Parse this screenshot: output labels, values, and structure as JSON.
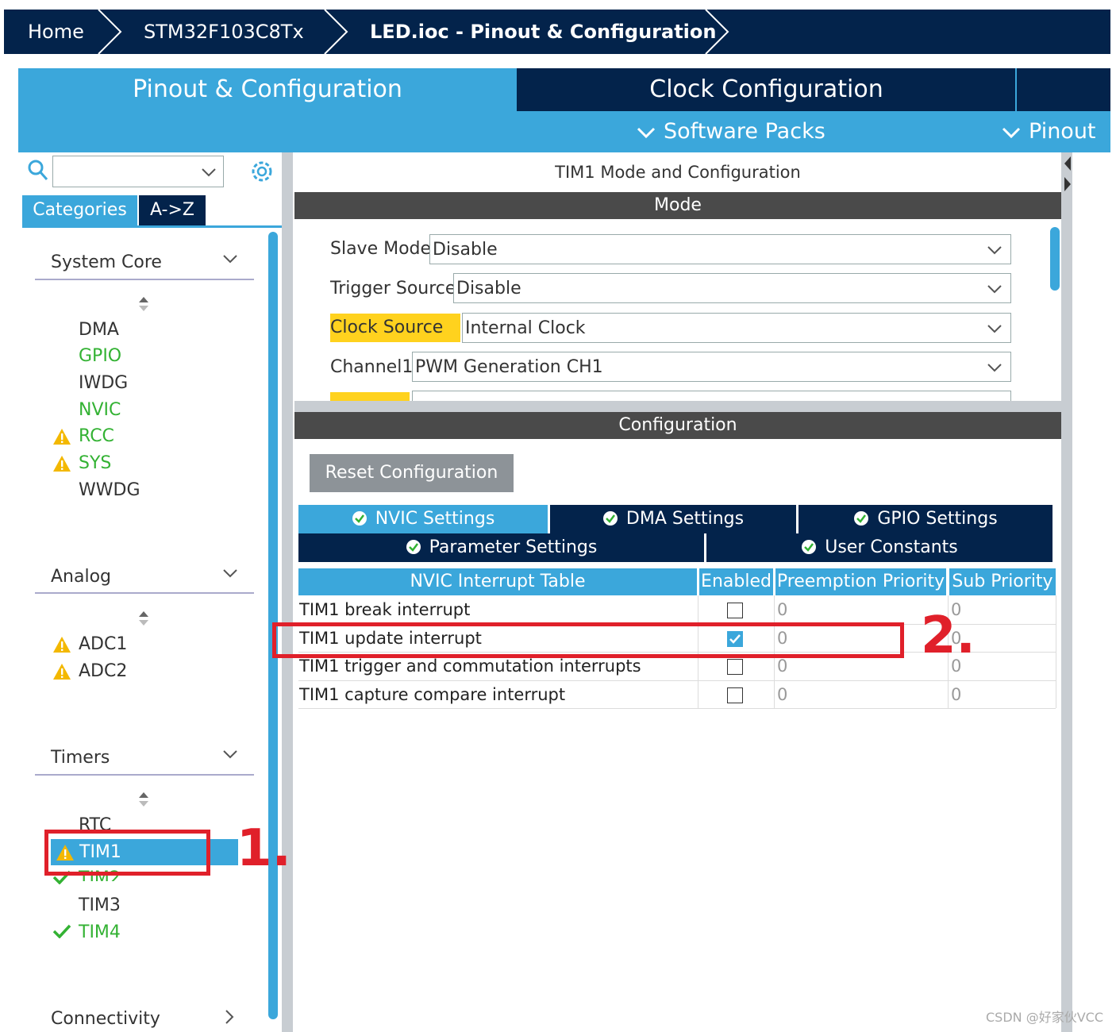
{
  "breadcrumb": {
    "items": [
      "Home",
      "STM32F103C8Tx",
      "LED.ioc - Pinout & Configuration"
    ]
  },
  "tabs": {
    "pinout_config": "Pinout & Configuration",
    "clock_config": "Clock Configuration",
    "software_packs": "Software Packs",
    "pinout": "Pinout"
  },
  "left": {
    "categories_tab": "Categories",
    "az_tab": "A->Z",
    "groups": {
      "system_core": "System Core",
      "analog": "Analog",
      "timers": "Timers",
      "connectivity": "Connectivity"
    },
    "system_core_items": [
      "DMA",
      "GPIO",
      "IWDG",
      "NVIC",
      "RCC",
      "SYS",
      "WWDG"
    ],
    "analog_items": [
      "ADC1",
      "ADC2"
    ],
    "timers_items": [
      "RTC",
      "TIM1",
      "TIM2",
      "TIM3",
      "TIM4"
    ]
  },
  "mode": {
    "title": "TIM1 Mode and Configuration",
    "section": "Mode",
    "fields": [
      {
        "label": "Slave Mode",
        "value": "Disable"
      },
      {
        "label": "Trigger Source",
        "value": "Disable"
      },
      {
        "label": "Clock Source",
        "value": "Internal Clock"
      },
      {
        "label": "Channel1",
        "value": "PWM Generation CH1"
      }
    ]
  },
  "configuration": {
    "section": "Configuration",
    "reset_button": "Reset Configuration",
    "settings_tabs": {
      "nvic": "NVIC Settings",
      "dma": "DMA Settings",
      "gpio": "GPIO Settings",
      "parameter": "Parameter Settings",
      "user_constants": "User Constants"
    },
    "table": {
      "headers": [
        "NVIC Interrupt Table",
        "Enabled",
        "Preemption Priority",
        "Sub Priority"
      ],
      "rows": [
        {
          "name": "TIM1 break interrupt",
          "enabled": false,
          "preemption": "0",
          "sub": "0"
        },
        {
          "name": "TIM1 update interrupt",
          "enabled": true,
          "preemption": "0",
          "sub": "0"
        },
        {
          "name": "TIM1 trigger and commutation interrupts",
          "enabled": false,
          "preemption": "0",
          "sub": "0"
        },
        {
          "name": "TIM1 capture compare interrupt",
          "enabled": false,
          "preemption": "0",
          "sub": "0"
        }
      ]
    }
  },
  "annotations": {
    "step1": "1.",
    "step2": "2."
  },
  "watermark": "CSDN @好家伙VCC",
  "colors": {
    "navy": "#03234b",
    "accent": "#3ba7db",
    "annotation_red": "#e0202a",
    "ok_green": "#33b233",
    "warning": "#f3b800"
  }
}
